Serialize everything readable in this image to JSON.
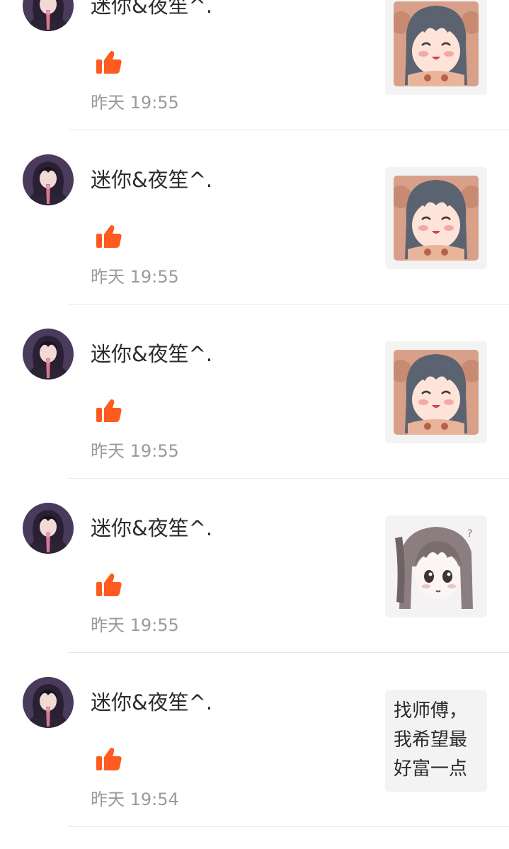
{
  "notifications": [
    {
      "user": "迷你&夜笙^.",
      "time": "昨天 19:55",
      "preview": {
        "type": "image",
        "image": "anime-girl-smiling"
      }
    },
    {
      "user": "迷你&夜笙^.",
      "time": "昨天 19:55",
      "preview": {
        "type": "image",
        "image": "anime-girl-smiling"
      }
    },
    {
      "user": "迷你&夜笙^.",
      "time": "昨天 19:55",
      "preview": {
        "type": "image",
        "image": "anime-girl-smiling"
      }
    },
    {
      "user": "迷你&夜笙^.",
      "time": "昨天 19:55",
      "preview": {
        "type": "image",
        "image": "anime-girl-sketch"
      }
    },
    {
      "user": "迷你&夜笙^.",
      "time": "昨天 19:54",
      "preview": {
        "type": "text",
        "text": "找师傅，我希望最好富一点"
      }
    }
  ],
  "icons": {
    "like": "thumbs-up-icon",
    "avatar": "hooded-character-avatar"
  },
  "colors": {
    "like": "#ff5a1f",
    "name_text": "#2b2b2b",
    "time_text": "#9a9a9a",
    "divider": "#e6e6e6",
    "preview_bg": "#f3f3f3"
  }
}
